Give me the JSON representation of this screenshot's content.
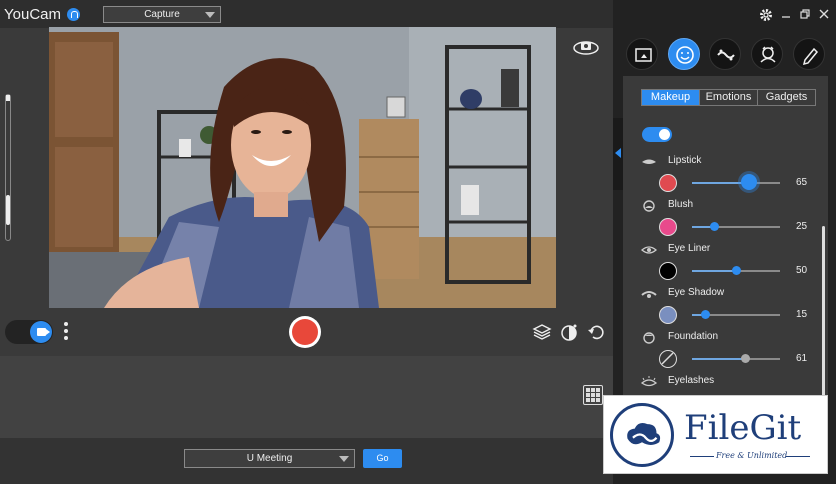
{
  "app": {
    "title": "YouCam"
  },
  "header": {
    "mode_value": "Capture"
  },
  "footer": {
    "meeting_value": "U Meeting",
    "go_label": "Go"
  },
  "right_panel": {
    "tabs": [
      {
        "label": "Makeup",
        "active": true
      },
      {
        "label": "Emotions",
        "active": false
      },
      {
        "label": "Gadgets",
        "active": false
      }
    ],
    "makeup_enabled": true,
    "features": [
      {
        "label": "Lipstick",
        "value": "65",
        "color": "#e04a50",
        "level": 0.65,
        "icon": "lips-icon"
      },
      {
        "label": "Blush",
        "value": "25",
        "color": "#e84a8c",
        "level": 0.25,
        "icon": "blush-icon"
      },
      {
        "label": "Eye Liner",
        "value": "50",
        "color": "#000000",
        "level": 0.5,
        "icon": "eye-liner-icon"
      },
      {
        "label": "Eye Shadow",
        "value": "15",
        "color": "#7a8fbf",
        "level": 0.15,
        "icon": "eye-shadow-icon"
      },
      {
        "label": "Foundation",
        "value": "61",
        "color": "none",
        "level": 0.61,
        "icon": "foundation-icon"
      },
      {
        "label": "Eyelashes",
        "value": "",
        "color": "",
        "level": null,
        "icon": "eyelashes-icon"
      }
    ]
  },
  "watermark": {
    "name": "FileGit",
    "tagline": "Free & Unlimited"
  },
  "colors": {
    "accent": "#2d8cf0",
    "record": "#e8483a",
    "watermark": "#1f3f7a"
  }
}
